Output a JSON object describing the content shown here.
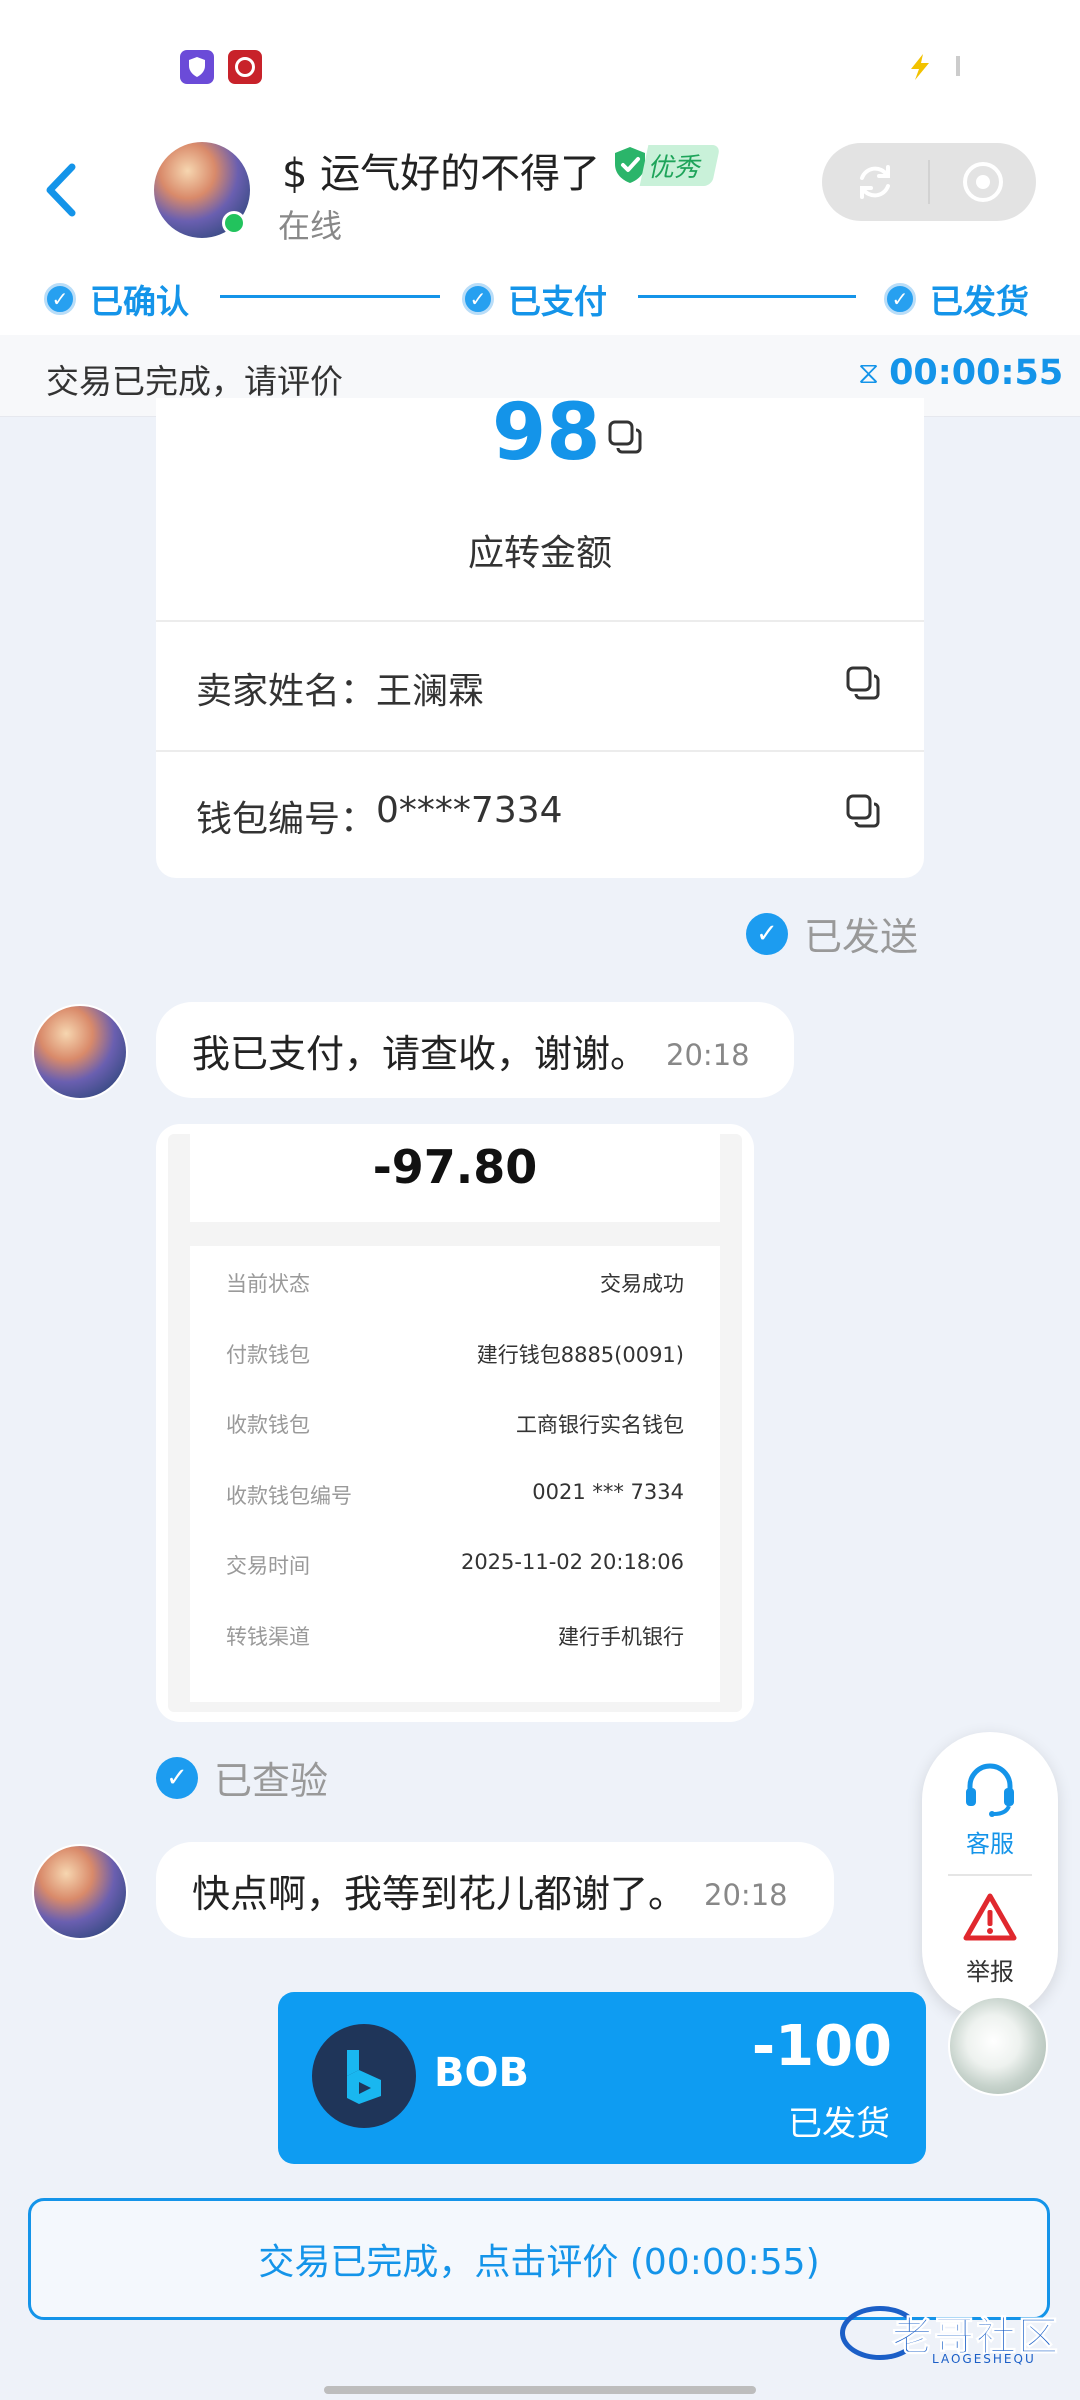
{
  "header": {
    "back_icon": "chevron-left-icon",
    "contact_name": "$ 运气好的不得了",
    "badge": "优秀",
    "status": "在线"
  },
  "steps": [
    {
      "label": "已确认"
    },
    {
      "label": "已支付"
    },
    {
      "label": "已发货"
    }
  ],
  "notice": {
    "text": "交易已完成，请评价",
    "timer": "00:00:55"
  },
  "order_card": {
    "amount": "98",
    "amount_caption": "应转金额",
    "seller_label": "卖家姓名：",
    "seller_name": "王澜霖",
    "wallet_label": "钱包编号：",
    "wallet_no": "0****7334",
    "sent_status": "已发送"
  },
  "messages": {
    "msg1_text": "我已支付，请查收，谢谢。",
    "msg1_time": "20:18",
    "msg2_text": "快点啊，我等到花儿都谢了。",
    "msg2_time": "20:18",
    "verified": "已查验"
  },
  "receipt": {
    "amount": "-97.80",
    "rows": [
      {
        "label": "当前状态",
        "value": "交易成功"
      },
      {
        "label": "付款钱包",
        "value": "建行钱包8885(0091)"
      },
      {
        "label": "收款钱包",
        "value": "工商银行实名钱包"
      },
      {
        "label": "收款钱包编号",
        "value": "0021 *** 7334"
      },
      {
        "label": "交易时间",
        "value": "2025-11-02 20:18:06"
      },
      {
        "label": "转钱渠道",
        "value": "建行手机银行"
      }
    ]
  },
  "side_panel": {
    "service_label": "客服",
    "report_label": "举报"
  },
  "bob_card": {
    "name": "BOB",
    "amount": "-100",
    "status": "已发货"
  },
  "footer": {
    "review_button": "交易已完成，点击评价 (00:00:55)",
    "watermark": "老哥社区",
    "watermark_sub": "LAOGESHEQU"
  },
  "colors": {
    "accent": "#1494e9",
    "bob_bg": "#0e9cf2",
    "online": "#22c35d",
    "badge": "#2bb56a"
  }
}
